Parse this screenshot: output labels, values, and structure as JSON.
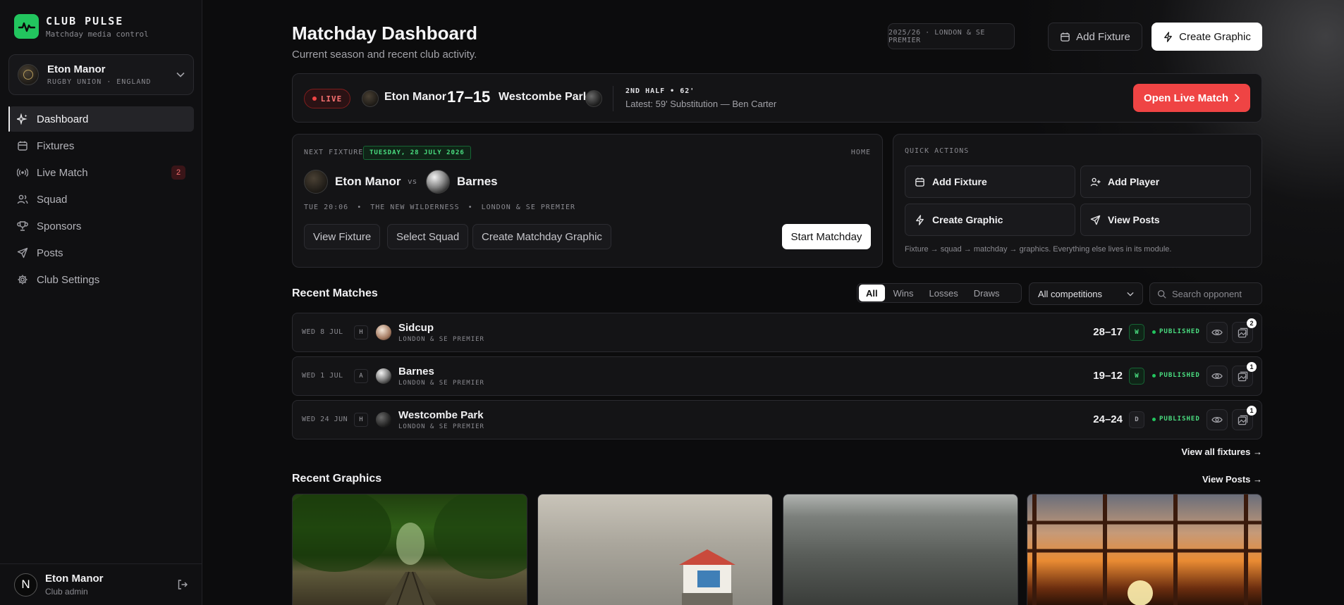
{
  "brand": {
    "name": "CLUB PULSE",
    "tagline": "Matchday media control",
    "accent": "#22c55e"
  },
  "club": {
    "name": "Eton Manor",
    "meta": "RUGBY UNION · ENGLAND"
  },
  "nav": [
    {
      "label": "Dashboard",
      "icon": "sparkle-icon",
      "active": true
    },
    {
      "label": "Fixtures",
      "icon": "calendar-icon"
    },
    {
      "label": "Live Match",
      "icon": "broadcast-icon",
      "badge": "2"
    },
    {
      "label": "Squad",
      "icon": "users-icon"
    },
    {
      "label": "Sponsors",
      "icon": "trophy-icon"
    },
    {
      "label": "Posts",
      "icon": "send-icon"
    },
    {
      "label": "Club Settings",
      "icon": "gear-icon"
    }
  ],
  "user": {
    "initial": "N",
    "name": "Eton Manor",
    "role": "Club admin"
  },
  "header": {
    "title": "Matchday Dashboard",
    "subtitle": "Current season and recent club activity.",
    "season": "2025/26 · LONDON & SE PREMIER",
    "add_fixture": "Add Fixture",
    "create_graphic": "Create Graphic"
  },
  "live": {
    "chip": "LIVE",
    "home": "Eton Manor",
    "score": "17–15",
    "away": "Westcombe Park",
    "phase": "2ND HALF • 62'",
    "latest": "Latest: 59' Substitution — Ben Carter",
    "open_button": "Open Live Match",
    "color": "#ef4444"
  },
  "next_fixture": {
    "label": "NEXT FIXTURE",
    "date": "TUESDAY, 28 JULY 2026",
    "venue_type": "HOME",
    "home": "Eton Manor",
    "vs": "vs",
    "away": "Barnes",
    "time": "TUE 20:06",
    "ground": "THE NEW WILDERNESS",
    "competition": "LONDON & SE PREMIER",
    "sep": "•",
    "buttons": {
      "view": "View Fixture",
      "squad": "Select Squad",
      "graphic": "Create Matchday Graphic",
      "start": "Start Matchday"
    }
  },
  "quick_actions": {
    "label": "QUICK ACTIONS",
    "items": [
      {
        "label": "Add Fixture",
        "icon": "calendar-icon"
      },
      {
        "label": "Add Player",
        "icon": "user-plus-icon"
      },
      {
        "label": "Create Graphic",
        "icon": "bolt-icon"
      },
      {
        "label": "View Posts",
        "icon": "send-icon"
      }
    ],
    "footer": "Fixture → squad → matchday → graphics. Everything else lives in its module."
  },
  "recent_matches": {
    "title": "Recent Matches",
    "filters": [
      "All",
      "Wins",
      "Losses",
      "Draws"
    ],
    "active_filter": "All",
    "competition_select": "All competitions",
    "search_placeholder": "Search opponent",
    "rows": [
      {
        "date": "WED 8 JUL",
        "ha": "H",
        "team": "Sidcup",
        "comp": "LONDON & SE PREMIER",
        "score": "28–17",
        "result": "W",
        "status": "PUBLISHED",
        "count": "2"
      },
      {
        "date": "WED 1 JUL",
        "ha": "A",
        "team": "Barnes",
        "comp": "LONDON & SE PREMIER",
        "score": "19–12",
        "result": "W",
        "status": "PUBLISHED",
        "count": "1"
      },
      {
        "date": "WED 24 JUN",
        "ha": "H",
        "team": "Westcombe Park",
        "comp": "LONDON & SE PREMIER",
        "score": "24–24",
        "result": "D",
        "status": "PUBLISHED",
        "count": "1"
      }
    ],
    "view_all": "View all fixtures →"
  },
  "recent_graphics": {
    "title": "Recent Graphics",
    "view_posts": "View Posts →"
  }
}
